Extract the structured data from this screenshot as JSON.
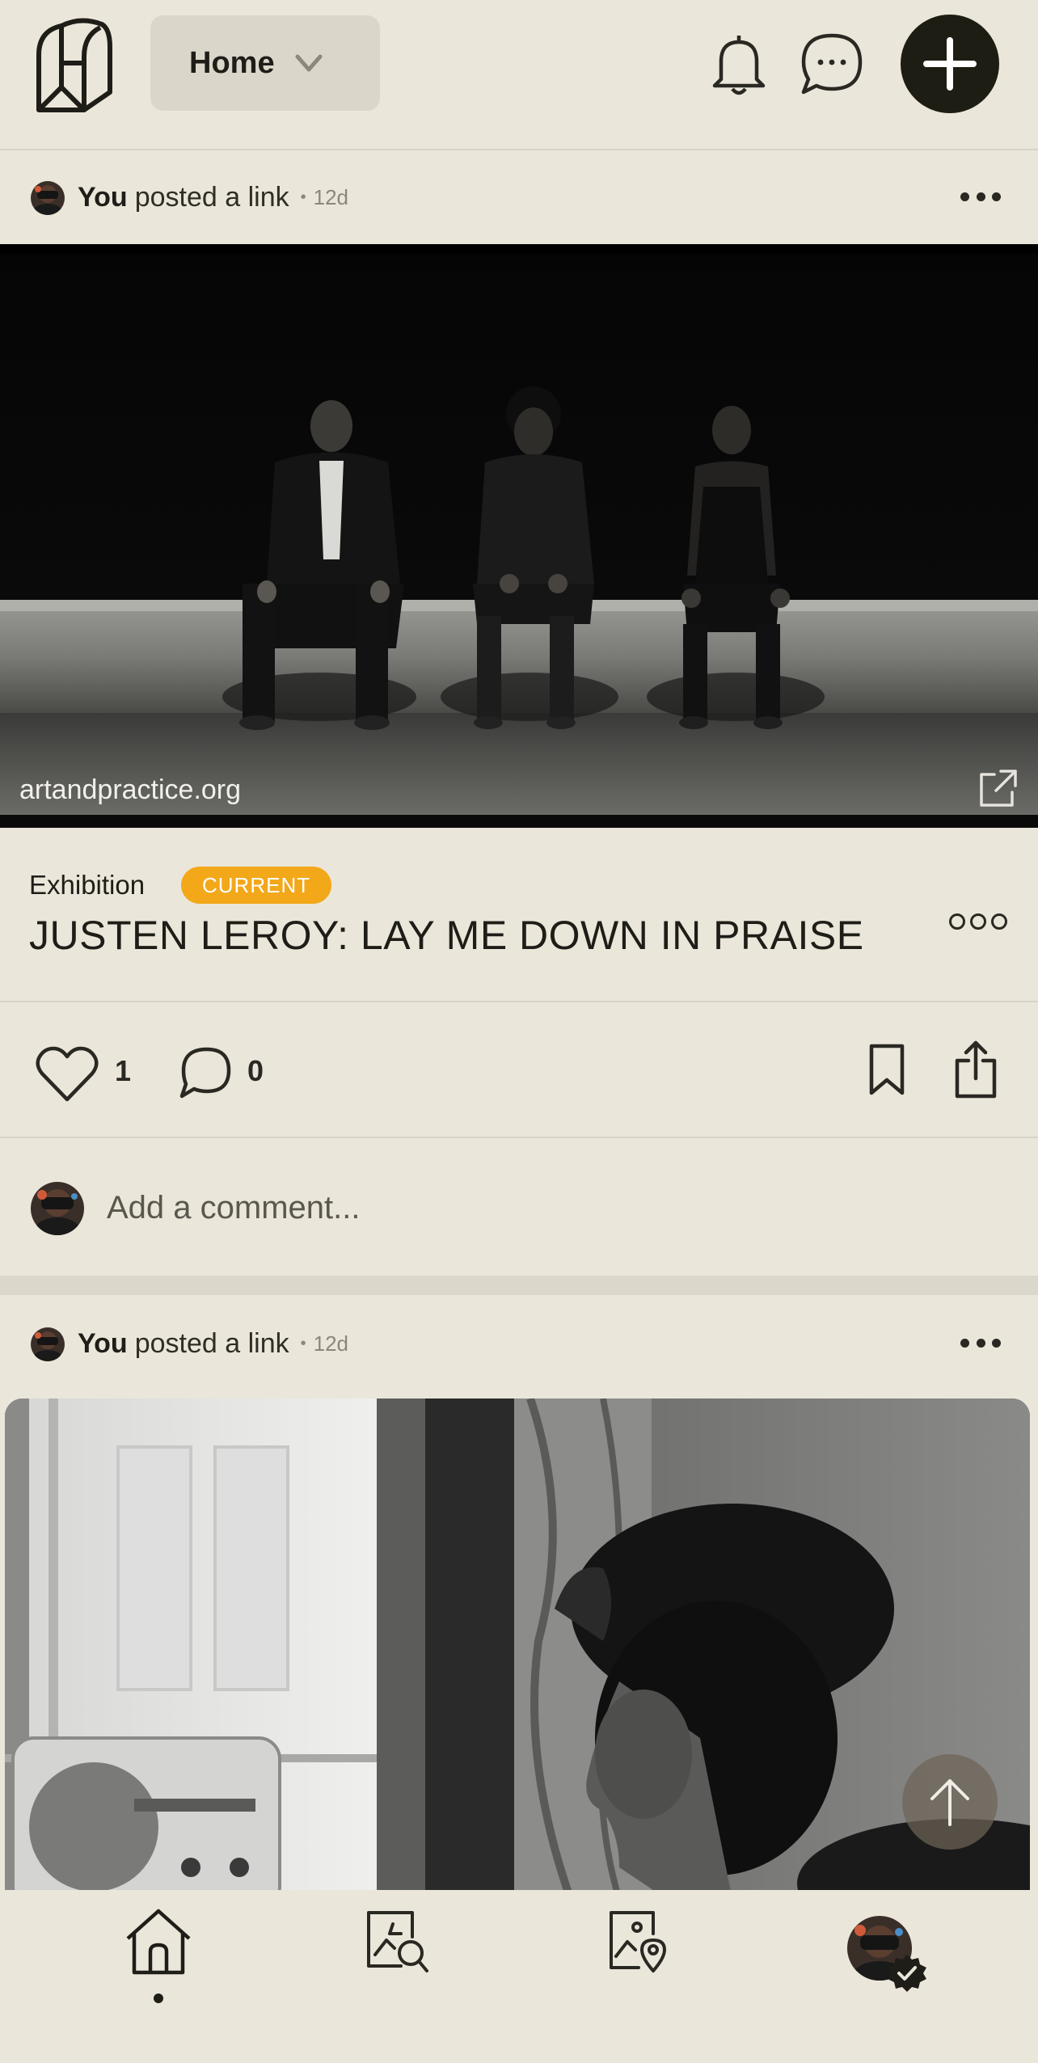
{
  "topbar": {
    "feed_label": "Home",
    "icons": [
      "logo-icon",
      "chevron-down-icon",
      "bell-icon",
      "chat-bubble-icon",
      "plus-icon"
    ]
  },
  "posts": [
    {
      "author": "You",
      "action": "posted a link",
      "time": "12d",
      "link_domain": "artandpractice.org",
      "category": "Exhibition",
      "status_badge": "CURRENT",
      "title": "JUSTEN LEROY: LAY ME DOWN IN PRAISE",
      "likes": "1",
      "comments": "0",
      "comment_placeholder": "Add a comment..."
    },
    {
      "author": "You",
      "action": "posted a link",
      "time": "12d"
    }
  ],
  "bottom_nav": {
    "items": [
      "home",
      "discover",
      "map",
      "profile"
    ],
    "active": "home"
  },
  "colors": {
    "background": "#ebe6da",
    "pill": "#dbd6ca",
    "badge": "#f3a81a",
    "dark": "#1e1d13"
  }
}
